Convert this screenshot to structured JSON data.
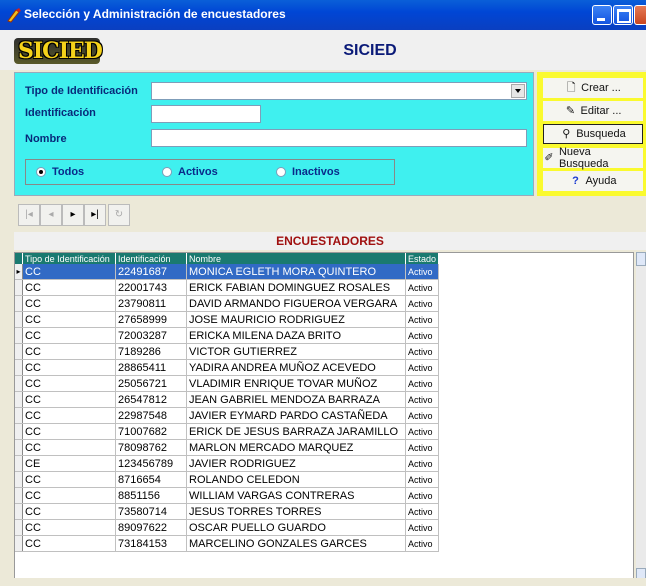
{
  "window": {
    "title": "Selección y Administración de encuestadores"
  },
  "banner": {
    "logo_text": "SICIED",
    "title": "SICIED"
  },
  "filters": {
    "tipo_label": "Tipo de Identificación",
    "tipo_value": "",
    "identificacion_label": "Identificación",
    "identificacion_value": "",
    "nombre_label": "Nombre",
    "nombre_value": "",
    "radios": [
      {
        "label": "Todos",
        "selected": true
      },
      {
        "label": "Activos",
        "selected": false
      },
      {
        "label": "Inactivos",
        "selected": false
      }
    ]
  },
  "actions": {
    "crear": "Crear ...",
    "editar": "Editar ...",
    "busqueda": "Busqueda",
    "nueva_busqueda": "Nueva Busqueda",
    "ayuda": "Ayuda"
  },
  "grid": {
    "title": "ENCUESTADORES",
    "columns": [
      "Tipo de Identificación",
      "Identificación",
      "Nombre",
      "Estado"
    ],
    "rows": [
      [
        "CC",
        "22491687",
        "MONICA EGLETH MORA QUINTERO",
        "Activo"
      ],
      [
        "CC",
        "22001743",
        "ERICK FABIAN DOMINGUEZ ROSALES",
        "Activo"
      ],
      [
        "CC",
        "23790811",
        "DAVID ARMANDO FIGUEROA VERGARA",
        "Activo"
      ],
      [
        "CC",
        "27658999",
        "JOSE MAURICIO RODRIGUEZ",
        "Activo"
      ],
      [
        "CC",
        "72003287",
        "ERICKA MILENA DAZA BRITO",
        "Activo"
      ],
      [
        "CC",
        "7189286",
        "VICTOR GUTIERREZ",
        "Activo"
      ],
      [
        "CC",
        "28865411",
        "YADIRA ANDREA MUÑOZ ACEVEDO",
        "Activo"
      ],
      [
        "CC",
        "25056721",
        "VLADIMIR ENRIQUE TOVAR MUÑOZ",
        "Activo"
      ],
      [
        "CC",
        "26547812",
        "JEAN GABRIEL MENDOZA BARRAZA",
        "Activo"
      ],
      [
        "CC",
        "22987548",
        "JAVIER EYMARD PARDO CASTAÑEDA",
        "Activo"
      ],
      [
        "CC",
        "71007682",
        "ERICK DE JESUS BARRAZA JARAMILLO",
        "Activo"
      ],
      [
        "CC",
        "78098762",
        "MARLON MERCADO MARQUEZ",
        "Activo"
      ],
      [
        "CE",
        "123456789",
        "JAVIER RODRIGUEZ",
        "Activo"
      ],
      [
        "CC",
        "8716654",
        "ROLANDO CELEDON",
        "Activo"
      ],
      [
        "CC",
        "8851156",
        "WILLIAM VARGAS CONTRERAS",
        "Activo"
      ],
      [
        "CC",
        "73580714",
        "JESUS TORRES TORRES",
        "Activo"
      ],
      [
        "CC",
        "89097622",
        "OSCAR PUELLO GUARDO",
        "Activo"
      ],
      [
        "CC",
        "73184153",
        "MARCELINO GONZALES GARCES",
        "Activo"
      ]
    ],
    "selected_row": 0
  }
}
